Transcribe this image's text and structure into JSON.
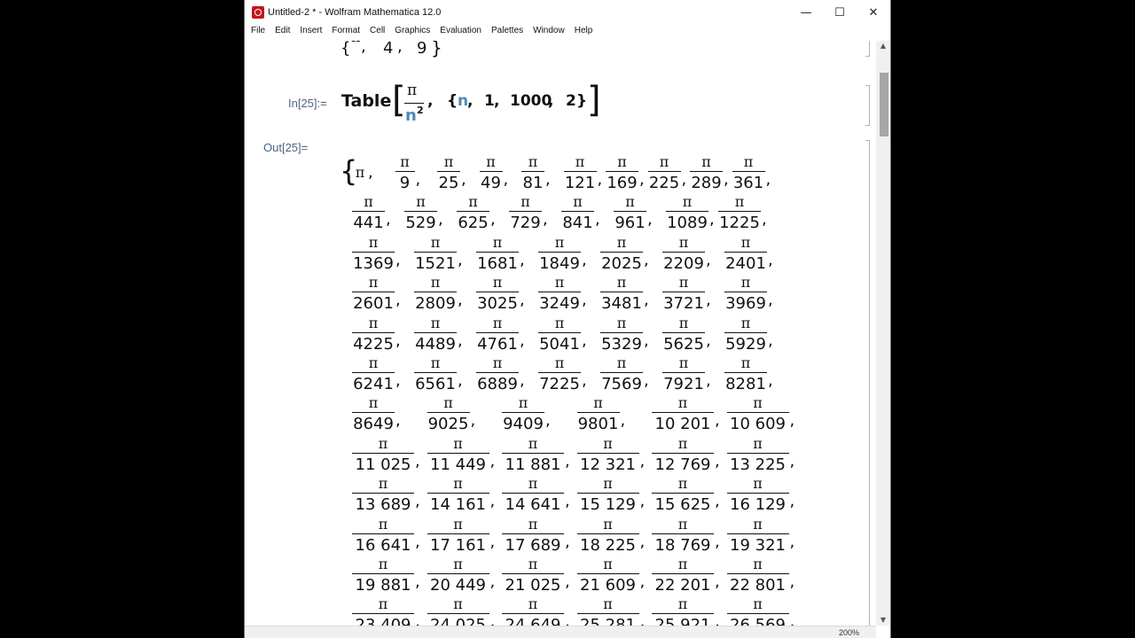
{
  "window": {
    "title": "Untitled-2 * - Wolfram Mathematica 12.0",
    "minimize": "—",
    "maximize": "☐",
    "close": "✕"
  },
  "menu": [
    "File",
    "Edit",
    "Insert",
    "Format",
    "Cell",
    "Graphics",
    "Evaluation",
    "Palettes",
    "Window",
    "Help"
  ],
  "prev_output": {
    "denominators": [
      "4",
      "9"
    ]
  },
  "input_cell": {
    "label": "In[25]:=",
    "func": "Table",
    "numerator": "π",
    "base": "n",
    "exponent": "2",
    "var": "n",
    "start": "1",
    "end": "1000",
    "step": "2"
  },
  "output_cell": {
    "label": "Out[25]=",
    "numerator": "π",
    "rows": [
      [
        "π",
        "9",
        "25",
        "49",
        "81",
        "121",
        "169",
        "225",
        "289",
        "361"
      ],
      [
        "441",
        "529",
        "625",
        "729",
        "841",
        "961",
        "1089",
        "1225"
      ],
      [
        "1369",
        "1521",
        "1681",
        "1849",
        "2025",
        "2209",
        "2401"
      ],
      [
        "2601",
        "2809",
        "3025",
        "3249",
        "3481",
        "3721",
        "3969"
      ],
      [
        "4225",
        "4489",
        "4761",
        "5041",
        "5329",
        "5625",
        "5929"
      ],
      [
        "6241",
        "6561",
        "6889",
        "7225",
        "7569",
        "7921",
        "8281"
      ],
      [
        "8649",
        "9025",
        "9409",
        "9801",
        "10 201",
        "10 609"
      ],
      [
        "11 025",
        "11 449",
        "11 881",
        "12 321",
        "12 769",
        "13 225"
      ],
      [
        "13 689",
        "14 161",
        "14 641",
        "15 129",
        "15 625",
        "16 129"
      ],
      [
        "16 641",
        "17 161",
        "17 689",
        "18 225",
        "18 769",
        "19 321"
      ],
      [
        "19 881",
        "20 449",
        "21 025",
        "21 609",
        "22 201",
        "22 801"
      ],
      [
        "23 409",
        "24 025",
        "24 649",
        "25 281",
        "25 921",
        "26 569"
      ]
    ]
  },
  "status": {
    "zoom": "200%"
  }
}
